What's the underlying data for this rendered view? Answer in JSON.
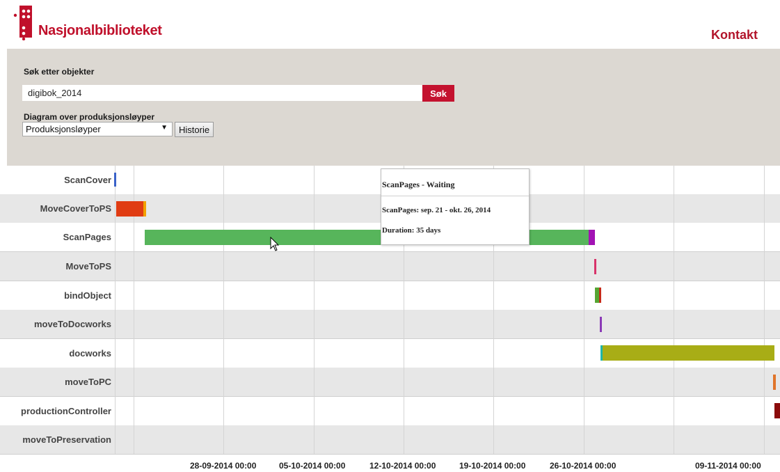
{
  "brand": {
    "name": "Nasjonalbiblioteket",
    "color": "#c0102b"
  },
  "nav": {
    "contact": "Kontakt"
  },
  "search": {
    "label": "Søk etter objekter",
    "value": "digibok_2014",
    "button": "Søk"
  },
  "diagram": {
    "label": "Diagram over produksjonsløyper",
    "selected": "Produksjonsløyper",
    "history_button": "Historie"
  },
  "gantt": {
    "rows": [
      {
        "label": "ScanCover"
      },
      {
        "label": "MoveCoverToPS"
      },
      {
        "label": "ScanPages"
      },
      {
        "label": "MoveToPS"
      },
      {
        "label": "bindObject"
      },
      {
        "label": "moveToDocworks"
      },
      {
        "label": "docworks"
      },
      {
        "label": "moveToPC"
      },
      {
        "label": "productionController"
      },
      {
        "label": "moveToPreservation"
      }
    ],
    "axis_labels": [
      "28-09-2014 00:00",
      "05-10-2014 00:00",
      "12-10-2014 00:00",
      "19-10-2014 00:00",
      "26-10-2014 00:00",
      "09-11-2014 00:00"
    ],
    "tooltip": {
      "title": "ScanPages - Waiting",
      "dates": "ScanPages: sep. 21 - okt. 26, 2014",
      "duration": "Duration: 35 days"
    }
  }
}
